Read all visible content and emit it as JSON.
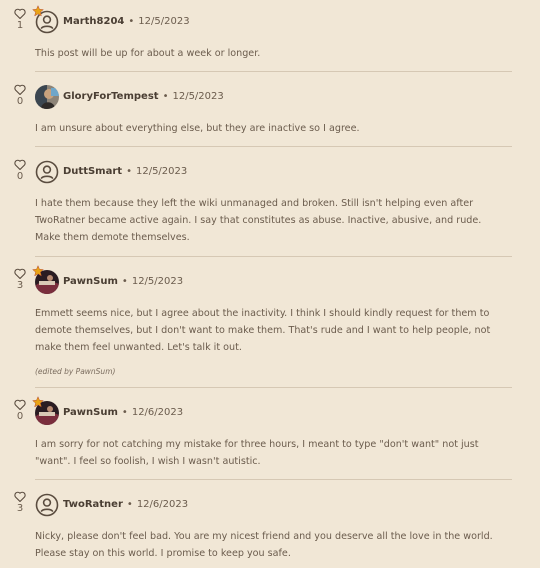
{
  "comments": [
    {
      "likes": "1",
      "username": "Marth8204",
      "date": "12/5/2023",
      "text": "This post will be up for about a week or longer.",
      "avatar": "default-user-icon",
      "badge": "star"
    },
    {
      "likes": "0",
      "username": "GloryForTempest",
      "date": "12/5/2023",
      "text": "I am unsure about everything else, but they are inactive so I agree.",
      "avatar": "photo-avatar"
    },
    {
      "likes": "0",
      "username": "DuttSmart",
      "date": "12/5/2023",
      "text": "I hate them because they left the wiki unmanaged and broken. Still isn't helping even after TwoRatner became active again. I say that constitutes as abuse. Inactive, abusive, and rude. Make them demote themselves.",
      "avatar": "default-user-icon"
    },
    {
      "likes": "3",
      "username": "PawnSum",
      "date": "12/5/2023",
      "text": "Emmett seems nice, but I agree about the inactivity. I think I should kindly request for them to demote themselves, but I don't want to make them. That's rude and I want to help people, not make them feel unwanted. Let's talk it out.",
      "edited": "(edited by PawnSum)",
      "avatar": "photo-avatar",
      "badge": "star"
    },
    {
      "likes": "0",
      "username": "PawnSum",
      "date": "12/6/2023",
      "text": "I am sorry for not catching my mistake for three hours, I meant to type \"don't want\" not just \"want\". I feel so foolish, I wish I wasn't autistic.",
      "avatar": "photo-avatar",
      "badge": "star"
    },
    {
      "likes": "3",
      "username": "TwoRatner",
      "date": "12/6/2023",
      "text": "Nicky, please don't feel bad. You are my nicest friend and you deserve all the love in the world. Please stay on this world. I promise to keep you safe.",
      "avatar": "default-user-icon"
    }
  ],
  "separator": "•",
  "colors": {
    "background": "#f1e7d6",
    "divider": "#d6c8b4",
    "text": "#6b5c4d",
    "username": "#4a3e33",
    "badge": "#e8a417"
  }
}
